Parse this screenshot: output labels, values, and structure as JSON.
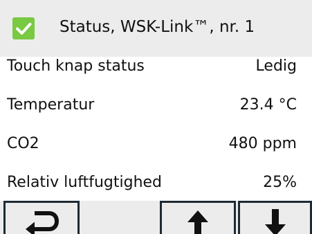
{
  "header": {
    "title": "Status, WSK-Link™, nr. 1",
    "status_icon": "checkmark-icon",
    "accent_color": "#7ac943"
  },
  "rows": [
    {
      "label": "Touch knap status",
      "value": "Ledig"
    },
    {
      "label": "Temperatur",
      "value": "23.4 °C"
    },
    {
      "label": "CO2",
      "value": "480 ppm"
    },
    {
      "label": "Relativ luftfugtighed",
      "value": "25%"
    }
  ],
  "buttons": {
    "back_icon": "return-arrow-icon",
    "up_icon": "arrow-up-icon",
    "down_icon": "arrow-down-icon"
  }
}
